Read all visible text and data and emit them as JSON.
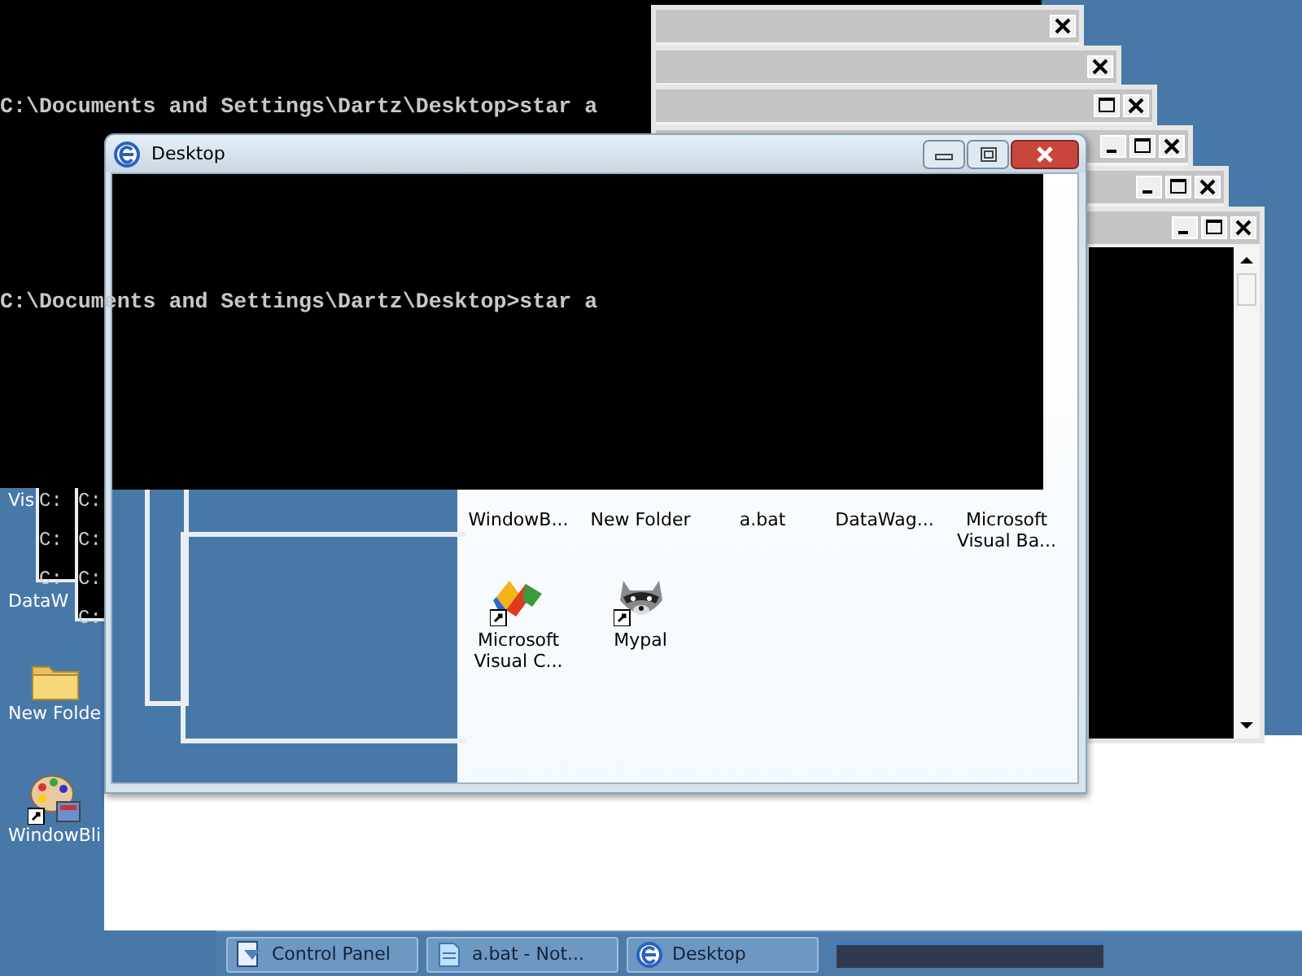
{
  "console": {
    "lines": [
      "C:\\Documents and Settings\\Dartz\\Desktop>star a",
      "C:\\Documents and Settings\\Dartz\\Desktop>star a"
    ]
  },
  "ghost_consoles": [
    {
      "lines": [
        "C:",
        "C:",
        "C:"
      ]
    },
    {
      "lines": [
        "C:",
        "C:",
        "C:",
        "C:"
      ]
    }
  ],
  "desktop_icons": [
    {
      "label": "Vis",
      "kind": "covered"
    },
    {
      "label": "DataW",
      "kind": "covered"
    },
    {
      "label": "New Folde",
      "kind": "folder"
    },
    {
      "label": "WindowBli",
      "kind": "palette"
    }
  ],
  "classic_windows": [
    {
      "buttons": [
        {
          "kind": "close"
        }
      ]
    },
    {
      "buttons": [
        {
          "kind": "close"
        }
      ]
    },
    {
      "buttons": [
        {
          "kind": "maximize"
        },
        {
          "kind": "close"
        }
      ]
    },
    {
      "buttons": [
        {
          "kind": "minimize"
        },
        {
          "kind": "maximize"
        },
        {
          "kind": "close"
        }
      ]
    },
    {
      "buttons": [
        {
          "kind": "minimize"
        },
        {
          "kind": "maximize"
        },
        {
          "kind": "close"
        }
      ]
    },
    {
      "buttons": [
        {
          "kind": "minimize"
        },
        {
          "kind": "maximize"
        },
        {
          "kind": "close"
        }
      ]
    }
  ],
  "explorer_window": {
    "title": "Desktop",
    "icons": [
      {
        "label": "WindowB...",
        "kind": "covered"
      },
      {
        "label": "New Folder",
        "kind": "covered"
      },
      {
        "label": "a.bat",
        "kind": "covered"
      },
      {
        "label": "DataWag...",
        "kind": "covered"
      },
      {
        "label": "Microsoft Visual Ba...",
        "kind": "covered"
      },
      {
        "label": "Microsoft Visual C...",
        "kind": "ribbon"
      },
      {
        "label": "Mypal",
        "kind": "raccoon"
      }
    ]
  },
  "taskbar": {
    "buttons": [
      {
        "label": "Control Panel",
        "kind": "control-panel"
      },
      {
        "label": "a.bat - Not...",
        "kind": "notepad"
      },
      {
        "label": "Desktop",
        "kind": "browser"
      }
    ]
  }
}
